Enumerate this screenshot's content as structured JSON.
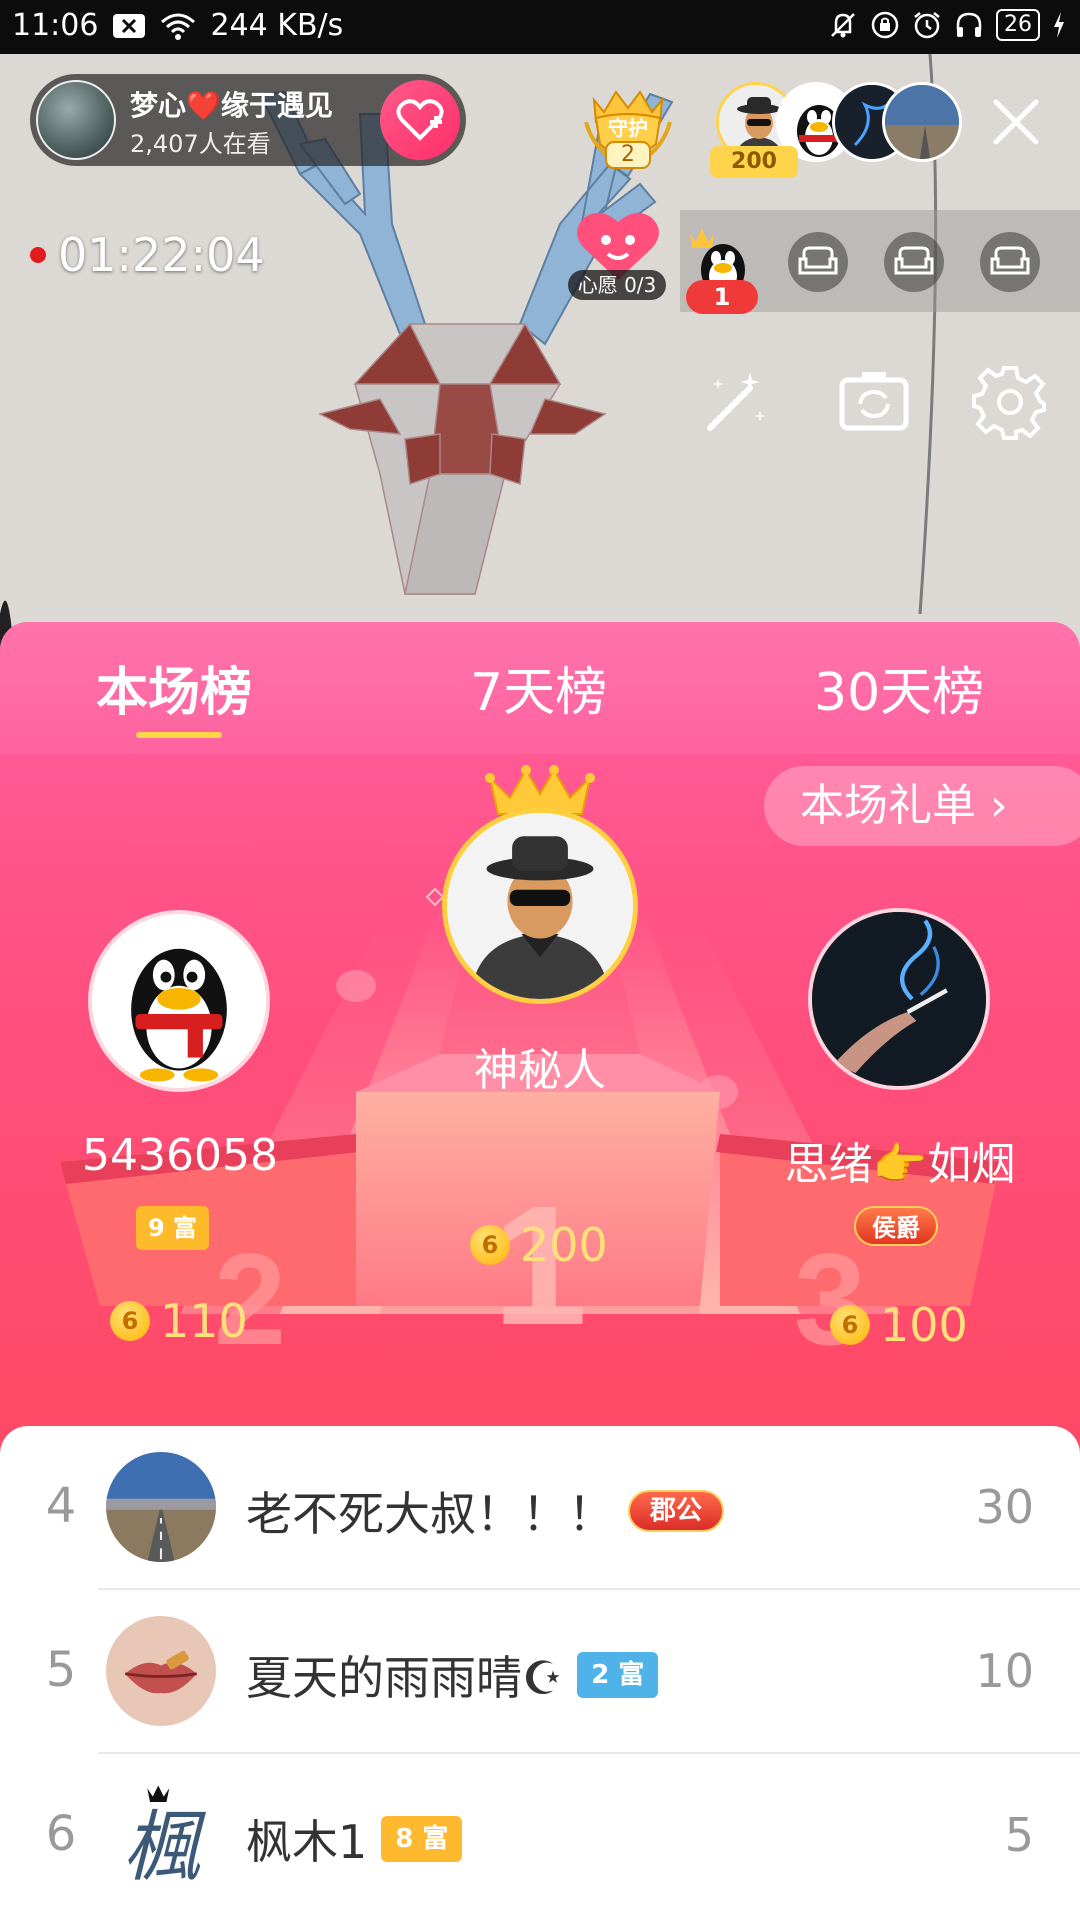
{
  "status_bar": {
    "time": "11:06",
    "network_speed": "244 KB/s",
    "battery": "26",
    "icons": [
      "notification-x-icon",
      "wifi-icon",
      "mute-bell-icon",
      "lock-rotation-icon",
      "alarm-icon",
      "headphone-icon",
      "battery-icon",
      "charging-icon"
    ]
  },
  "live": {
    "host_name": "梦心❤️缘于遇见",
    "viewers": "2,407人在看",
    "guard_label": "守护",
    "guard_count": "2",
    "top_contrib_value": "200",
    "timer": "01:22:04",
    "wish_label": "心愿 0/3",
    "seat_number": "1"
  },
  "tabs": [
    {
      "label": "本场榜",
      "active": true
    },
    {
      "label": "7天榜",
      "active": false
    },
    {
      "label": "30天榜",
      "active": false
    }
  ],
  "gift_list_button": "本场礼单 ›",
  "podium": {
    "first": {
      "rank": "1",
      "name": "神秘人",
      "score": "200"
    },
    "second": {
      "rank": "2",
      "name": "5436058",
      "tag": "9 富",
      "score": "110"
    },
    "third": {
      "rank": "3",
      "name": "思绪👉如烟",
      "tag": "侯爵",
      "score": "100"
    }
  },
  "list": [
    {
      "rank": "4",
      "name": "老不死大叔！！！",
      "tag": "郡公",
      "tag_type": "noble",
      "score": "30"
    },
    {
      "rank": "5",
      "name": "夏天的雨雨晴☪",
      "tag": "2 富",
      "tag_type": "rich",
      "tag_color": "#4fb3ea",
      "score": "10"
    },
    {
      "rank": "6",
      "name": "枫木1",
      "tag": "8 富",
      "tag_type": "rich",
      "tag_color": "#ffb92e",
      "score": "5"
    }
  ],
  "coin_symbol": "6",
  "colors": {
    "accent_pink": "#ff5994",
    "gold": "#ffd54a",
    "score_gold": "#ffe07a"
  }
}
